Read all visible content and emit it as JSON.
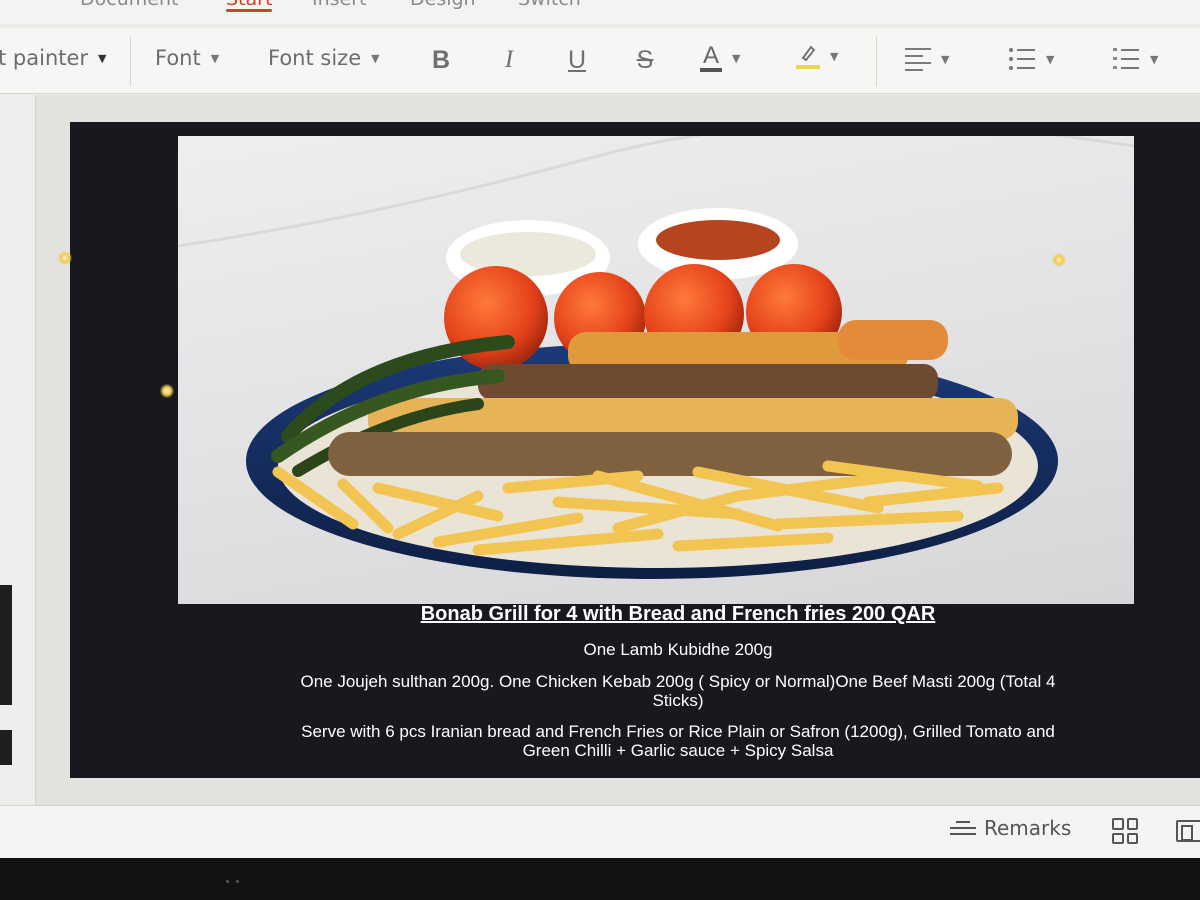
{
  "menu_tabs": [
    {
      "label": "Document",
      "active": false
    },
    {
      "label": "Start",
      "active": true
    },
    {
      "label": "Insert",
      "active": false
    },
    {
      "label": "Design",
      "active": false
    },
    {
      "label": "Switch",
      "active": false
    }
  ],
  "toolbar": {
    "format_painter": "t painter",
    "font": "Font",
    "font_size": "Font size",
    "bold": "B",
    "italic": "I",
    "underline": "U",
    "strikethrough": "S",
    "font_color": "A",
    "icons": [
      "highlight-icon",
      "align-left-icon",
      "bullet-list-icon",
      "numbered-list-icon",
      "chevron-down-icon"
    ]
  },
  "slide": {
    "title": "Bonab Grill for 4 with Bread and French fries 200 QAR",
    "line1": "One Lamb Kubidhe 200g",
    "line2a": "One   Joujeh sulthan 200g. One Chicken Kebab 200g  ( Spicy or Normal)One Beef Masti 200g (Total 4",
    "line2b": "Sticks)",
    "line3a": "Serve with 6 pcs Iranian bread and French Fries or Rice Plain or Safron (1200g), Grilled Tomato and",
    "line3b": "Green Chilli + Garlic sauce + Spicy Salsa"
  },
  "statusbar": {
    "remarks": "Remarks",
    "icons": [
      "remarks-icon",
      "grid-view-icon",
      "slide-view-icon"
    ]
  },
  "colors": {
    "accent": "#c8442c",
    "slide_bg": "#18191f",
    "caption_text": "#ffffff"
  }
}
